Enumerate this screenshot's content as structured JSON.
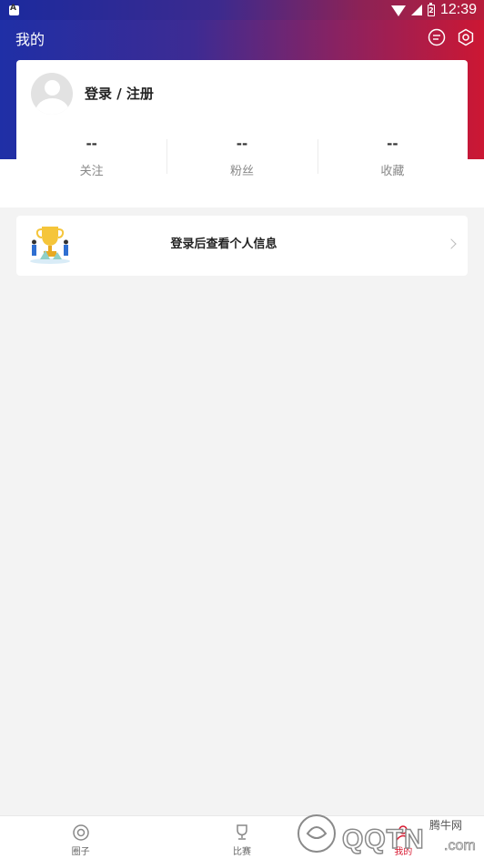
{
  "status_bar": {
    "time": "12:39",
    "battery_level": "2"
  },
  "header": {
    "title": "我的",
    "icons": [
      "message-icon",
      "settings-icon"
    ]
  },
  "profile": {
    "login_label": "登录 / 注册",
    "stats": [
      {
        "value": "--",
        "label": "关注"
      },
      {
        "value": "--",
        "label": "粉丝"
      },
      {
        "value": "--",
        "label": "收藏"
      }
    ]
  },
  "info_card": {
    "text": "登录后查看个人信息"
  },
  "tab_bar": {
    "tabs": [
      {
        "label": "圈子",
        "icon": "circle-icon",
        "active": false
      },
      {
        "label": "比赛",
        "icon": "trophy-icon",
        "active": false
      },
      {
        "label": "我的",
        "icon": "profile-icon",
        "active": true
      }
    ]
  },
  "watermark": {
    "site": "QQTN",
    "domain_suffix": ".com",
    "brand": "腾牛网"
  },
  "colors": {
    "accent": "#d8172f",
    "header_start": "#1f2fa6",
    "header_end": "#cc1733"
  }
}
